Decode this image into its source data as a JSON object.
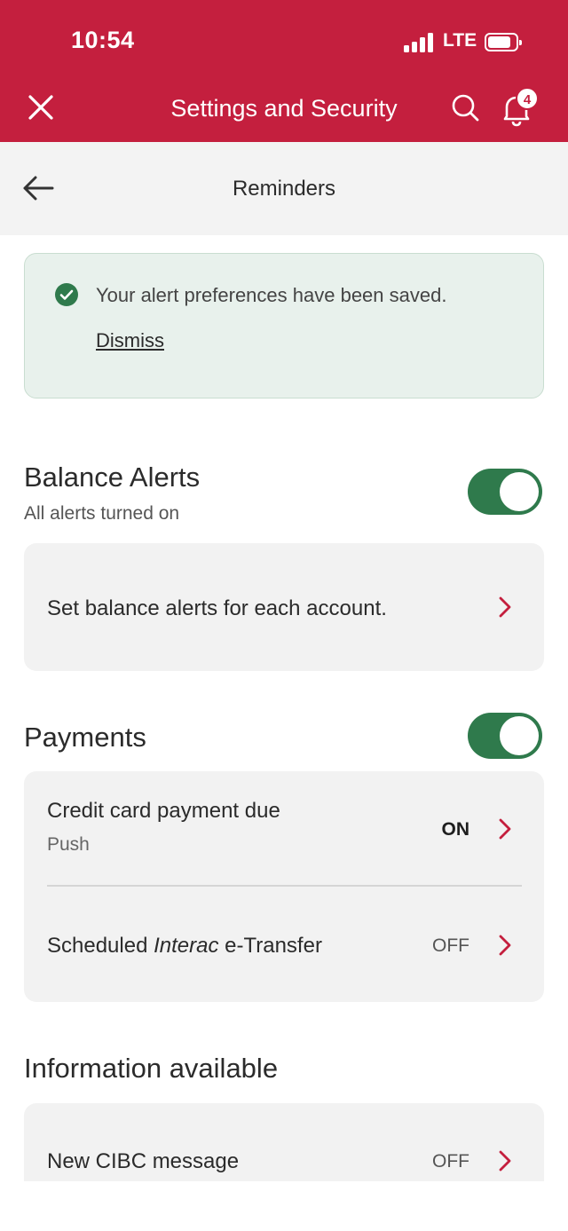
{
  "status_bar": {
    "time": "10:54",
    "network": "LTE",
    "icons": [
      "signal-icon",
      "battery-icon"
    ]
  },
  "header": {
    "title": "Settings and Security",
    "notification_count": "4",
    "icons": [
      "close-icon",
      "search-icon",
      "bell-icon"
    ],
    "background_color": "#c41f3e"
  },
  "subheader": {
    "title": "Reminders",
    "icon": "back-arrow-icon"
  },
  "confirmation": {
    "message": "Your alert preferences have been saved.",
    "dismiss_label": "Dismiss",
    "icon": "check-circle-icon"
  },
  "balance_alerts": {
    "title": "Balance Alerts",
    "subtitle": "All alerts turned on",
    "toggle_on": true,
    "row_label": "Set balance alerts for each account."
  },
  "payments": {
    "title": "Payments",
    "toggle_on": true,
    "rows": [
      {
        "label": "Credit card payment due",
        "sub": "Push",
        "status": "ON"
      },
      {
        "label_pre": "Scheduled ",
        "label_italic": "Interac",
        "label_post": " e-Transfer",
        "status": "OFF"
      }
    ]
  },
  "information": {
    "title": "Information available",
    "rows": [
      {
        "label": "New CIBC message",
        "status": "OFF"
      }
    ]
  },
  "colors": {
    "accent": "#c41f3e",
    "toggle_on": "#2f7a4c",
    "success": "#2f7a4c"
  }
}
